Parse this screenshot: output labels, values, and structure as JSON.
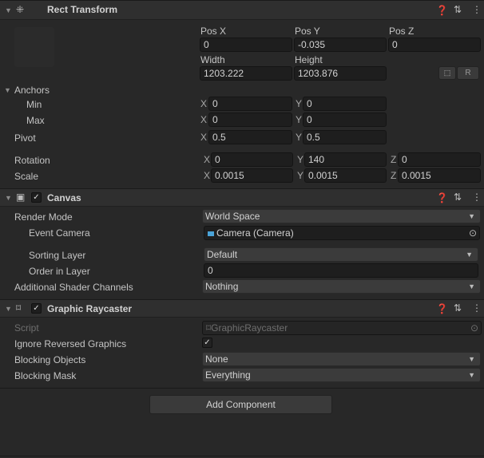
{
  "rect_transform": {
    "title": "Rect Transform",
    "pos_x_label": "Pos X",
    "pos_y_label": "Pos Y",
    "pos_z_label": "Pos Z",
    "pos_x": "0",
    "pos_y": "-0.035",
    "pos_z": "0",
    "width_label": "Width",
    "height_label": "Height",
    "width": "1203.222",
    "height": "1203.876",
    "raw_button": "R",
    "anchors_label": "Anchors",
    "min_label": "Min",
    "max_label": "Max",
    "min_x": "0",
    "min_y": "0",
    "max_x": "0",
    "max_y": "0",
    "pivot_label": "Pivot",
    "pivot_x": "0.5",
    "pivot_y": "0.5",
    "rotation_label": "Rotation",
    "rot_x": "0",
    "rot_y": "140",
    "rot_z": "0",
    "scale_label": "Scale",
    "scale_x": "0.0015",
    "scale_y": "0.0015",
    "scale_z": "0.0015",
    "axis_x": "X",
    "axis_y": "Y",
    "axis_z": "Z"
  },
  "canvas": {
    "title": "Canvas",
    "enabled": true,
    "render_mode_label": "Render Mode",
    "render_mode": "World Space",
    "event_camera_label": "Event Camera",
    "event_camera": "Camera (Camera)",
    "sorting_layer_label": "Sorting Layer",
    "sorting_layer": "Default",
    "order_label": "Order in Layer",
    "order": "0",
    "shader_channels_label": "Additional Shader Channels",
    "shader_channels": "Nothing"
  },
  "raycaster": {
    "title": "Graphic Raycaster",
    "enabled": true,
    "script_label": "Script",
    "script": "GraphicRaycaster",
    "ignore_reversed_label": "Ignore Reversed Graphics",
    "ignore_reversed": true,
    "blocking_objects_label": "Blocking Objects",
    "blocking_objects": "None",
    "blocking_mask_label": "Blocking Mask",
    "blocking_mask": "Everything"
  },
  "add_component": "Add Component",
  "icons": {
    "camera_color": "#4aa3d8"
  }
}
